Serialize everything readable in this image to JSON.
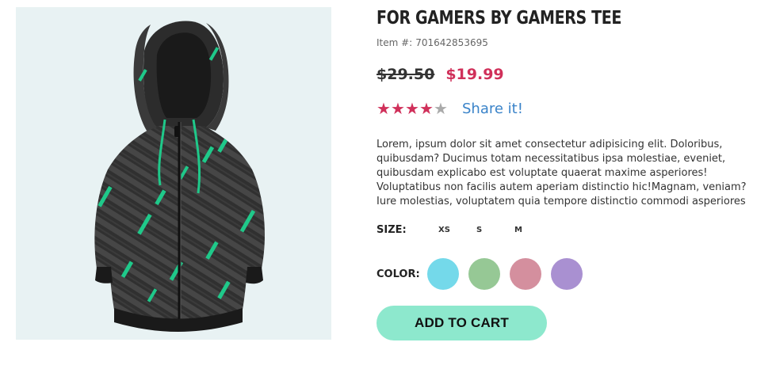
{
  "product": {
    "title": "FOR GAMERS BY GAMERS TEE",
    "item_label": "Item #:",
    "item_number": "701642853695",
    "old_price": "$29.50",
    "new_price": "$19.99",
    "rating": 4,
    "rating_max": 5,
    "share_label": "Share it!",
    "description": "Lorem, ipsum dolor sit amet consectetur adipisicing elit. Doloribus, quibusdam? Ducimus totam necessitatibus ipsa molestiae, eveniet, quibusdam explicabo est voluptate quaerat maxime asperiores! Voluptatibus non facilis autem aperiam distinctio hic!Magnam, veniam? Iure molestias, voluptatem quia tempore distinctio commodi asperiores",
    "size_label": "SIZE:",
    "sizes": [
      "XS",
      "S",
      "M"
    ],
    "color_label": "COLOR:",
    "colors": [
      "#74d9ea",
      "#96c895",
      "#d48f9e",
      "#a990d1"
    ],
    "add_to_cart_label": "ADD TO CART"
  },
  "colors": {
    "accent_price": "#d0305a",
    "share_link": "#3a83c9",
    "cart_button": "#8de8cd",
    "image_background": "#e8f2f3"
  }
}
